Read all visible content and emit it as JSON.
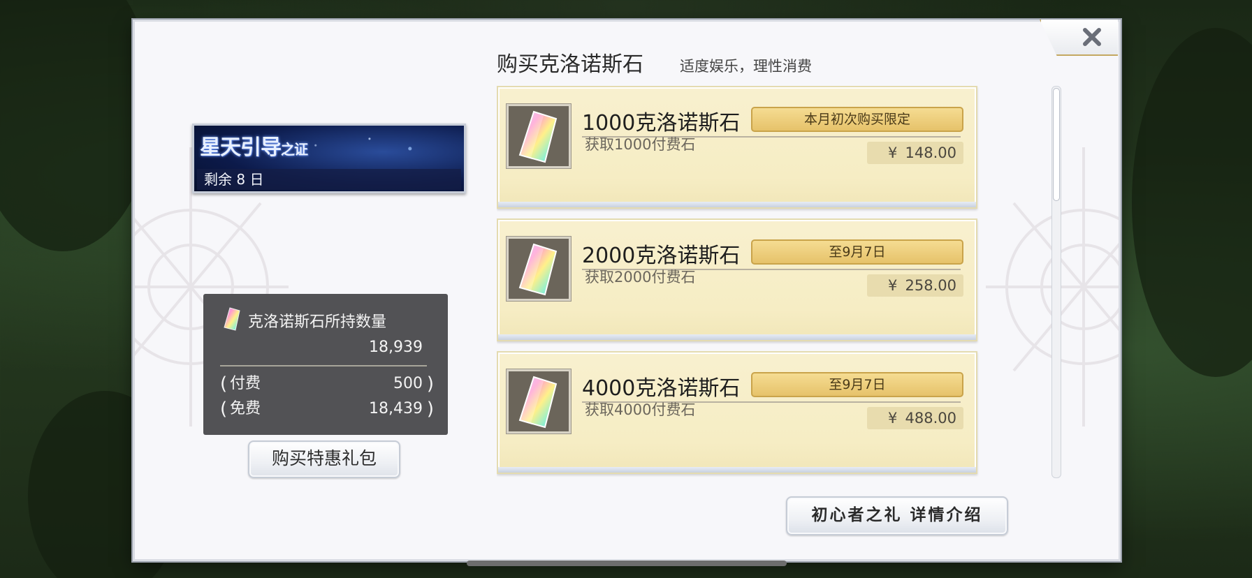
{
  "panel": {
    "title": "购买克洛诺斯石",
    "subtitle": "适度娱乐，理性消费"
  },
  "event": {
    "logo_text_main": "星天引导",
    "logo_text_small": "之证",
    "remaining": "剩余 8 日"
  },
  "holdings": {
    "title": "克洛诺斯石所持数量",
    "total": "18,939",
    "paid_label": "付费",
    "paid_value": "500",
    "free_label": "免费",
    "free_value": "18,439",
    "paren_open": "(",
    "paren_close": ")"
  },
  "buttons": {
    "gift_pack": "购买特惠礼包",
    "beginner": "初心者之礼 详情介绍"
  },
  "products": [
    {
      "name": "1000克洛诺斯石",
      "desc": "获取1000付费石",
      "badge": "本月初次购买限定",
      "currency": "¥",
      "price": "148.00"
    },
    {
      "name": "2000克洛诺斯石",
      "desc": "获取2000付费石",
      "badge": "至9月7日",
      "currency": "¥",
      "price": "258.00"
    },
    {
      "name": "4000克洛诺斯石",
      "desc": "获取4000付费石",
      "badge": "至9月7日",
      "currency": "¥",
      "price": "488.00"
    }
  ],
  "icons": {
    "close": "close-icon",
    "gem": "chronos-stone-icon"
  }
}
